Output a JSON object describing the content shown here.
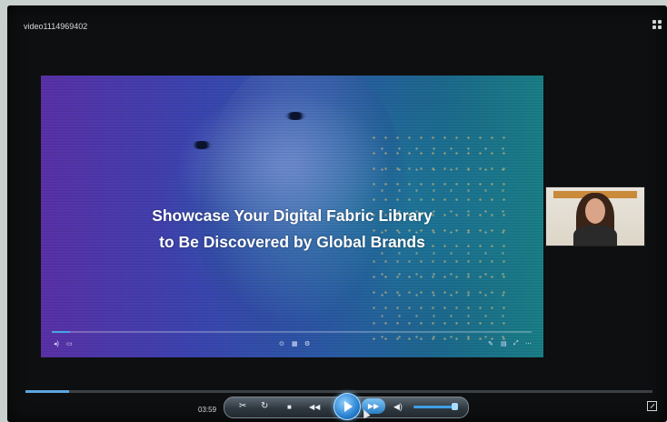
{
  "window": {
    "title": "video1114969402"
  },
  "slide": {
    "headline_line1": "Showcase Your Digital Fabric Library",
    "headline_line2": "to Be Discovered by Global Brands"
  },
  "player": {
    "elapsed_time": "03:59",
    "progress_fraction": 0.07,
    "volume_fraction": 0.85
  },
  "icons": {
    "top_right": "grid-icon",
    "cut": "scissors-icon",
    "replay": "replay-icon",
    "stop": "stop-icon",
    "rewind": "rewind-icon",
    "play": "play-icon",
    "fast_forward": "fast-forward-icon",
    "volume": "speaker-icon",
    "fullscreen": "fullscreen-icon"
  },
  "colors": {
    "accent": "#2a82d2",
    "seek_fill": "#5aa7e0"
  }
}
